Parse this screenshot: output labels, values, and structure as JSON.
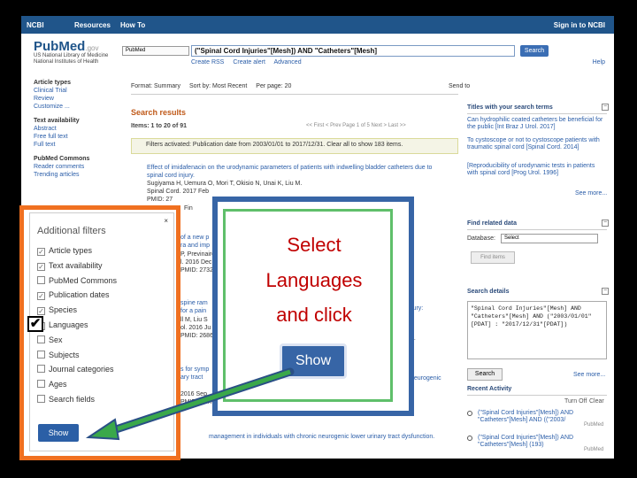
{
  "ncbi_bar": {
    "logo": "NCBI",
    "resources": "Resources",
    "how_to": "How To",
    "sign_in": "Sign in to NCBI"
  },
  "header": {
    "logo_pub": "Pub",
    "logo_med": "Med",
    "logo_gov": ".gov",
    "nlm": "US National Library of Medicine National Institutes of Health",
    "database": "PubMed",
    "query": "(\"Spinal Cord Injuries\"[Mesh]) AND \"Catheters\"[Mesh]",
    "search_label": "Search",
    "create_rss": "Create RSS",
    "create_alert": "Create alert",
    "advanced": "Advanced",
    "help": "Help"
  },
  "left_filters": {
    "article_types": "Article types",
    "clinical_trial": "Clinical Trial",
    "review": "Review",
    "customize": "Customize ...",
    "text_availability": "Text availability",
    "abstract": "Abstract",
    "free_full_text": "Free full text",
    "full_text": "Full text",
    "pubmed_commons": "PubMed Commons",
    "reader_comments": "Reader comments",
    "trending_articles": "Trending articles"
  },
  "results": {
    "format": "Format: Summary",
    "sort": "Sort by: Most Recent",
    "per_page": "Per page: 20",
    "send_to": "Send to",
    "title": "Search results",
    "items": "Items: 1 to 20 of 91",
    "pager": "<< First   < Prev   Page  1  of 5  Next >  Last >>",
    "filters_activated": "Filters activated: Publication date from 2003/01/01 to 2017/12/31. Clear all to show 183 items.",
    "r1_title": "Effect of imidafenacin on the urodynamic parameters of patients with indwelling bladder catheters due to spinal cord injury.",
    "r1_authors": "Sugiyama H, Uemura O, Mori T, Okisio N, Unai K, Liu M.",
    "r1_journal": "Spinal Cord. 2017 Feb",
    "r1_id": "PMID: 27",
    "r2_frag": "of a new p",
    "r2_frag2": "ra and imp",
    "r2_meta": "P, Previnaire",
    "r2_meta2": "l. 2016 Dec",
    "r2_id": "PMID: 27324315",
    "r3_frag": "spine ram",
    "r3_frag2": "for a pain",
    "r3_meta": "ll M, Liu S",
    "r3_meta2": "ol. 2016 Ju",
    "r3_id": "PMID: 26865",
    "r4_frag": "s for symp",
    "r4_frag2": "ary tract",
    "r4_meta": "2016 Sep",
    "r4_id": "PMID: 26473",
    "r5_frag": "management in individuals with chronic neurogenic lower urinary tract dysfunction.",
    "frag_cord_injury": "cord injury:",
    "frag_action": "ction",
    "frag_neurogenic": "neurogenic",
    "frag_2": "2.",
    "frag_finc": "Fin"
  },
  "right_col": {
    "titles_header": "Titles with your search terms",
    "t1": "Can hydrophilic coated catheters be beneficial for the public [Int Braz J Urol. 2017]",
    "t2": "To cystoscope or not to cystoscope patients with traumatic spinal cord [Spinal Cord. 2014]",
    "t3": "[Reproducibility of urodynamic tests in patients with spinal cord [Prog Urol. 1996]",
    "see_more": "See more...",
    "find_related": "Find related data",
    "database_label": "Database:",
    "database_select": "Select",
    "find_items": "Find items",
    "search_details": "Search details",
    "details_text": "\"Spinal Cord Injuries\"[Mesh] AND \"Catheters\"[Mesh] AND (\"2003/01/01\"[PDAT] : \"2017/12/31\"[PDAT])",
    "search_btn": "Search",
    "see_more2": "See more...",
    "recent_activity": "Recent Activity",
    "turn_off": "Turn Off",
    "clear": "Clear",
    "ra1": "(\"Spinal Cord Injuries\"[Mesh]) AND \"Catheters\"[Mesh] AND ((\"2003/",
    "ra1_src": "PubMed",
    "ra2": "(\"Spinal Cord Injuries\"[Mesh]) AND \"Catheters\"[Mesh] (193)",
    "ra2_src": "PubMed"
  },
  "overlay": {
    "line1": "Select",
    "line2": "Languages",
    "line3": "and click",
    "show_callout": "Show",
    "arrow_color": "#3aa84a",
    "frame_blue": "#3765a6",
    "frame_orange": "#f07020",
    "frame_green": "#5fbf6a"
  },
  "additional_filters": {
    "title": "Additional filters",
    "close": "×",
    "items": [
      {
        "label": "Article types",
        "checked": true
      },
      {
        "label": "Text availability",
        "checked": true
      },
      {
        "label": "PubMed Commons",
        "checked": false
      },
      {
        "label": "Publication dates",
        "checked": true
      },
      {
        "label": "Species",
        "checked": true
      },
      {
        "label": "Languages",
        "checked": true
      },
      {
        "label": "Sex",
        "checked": false
      },
      {
        "label": "Subjects",
        "checked": false
      },
      {
        "label": "Journal categories",
        "checked": false
      },
      {
        "label": "Ages",
        "checked": false
      },
      {
        "label": "Search fields",
        "checked": false
      }
    ],
    "show_button": "Show"
  }
}
